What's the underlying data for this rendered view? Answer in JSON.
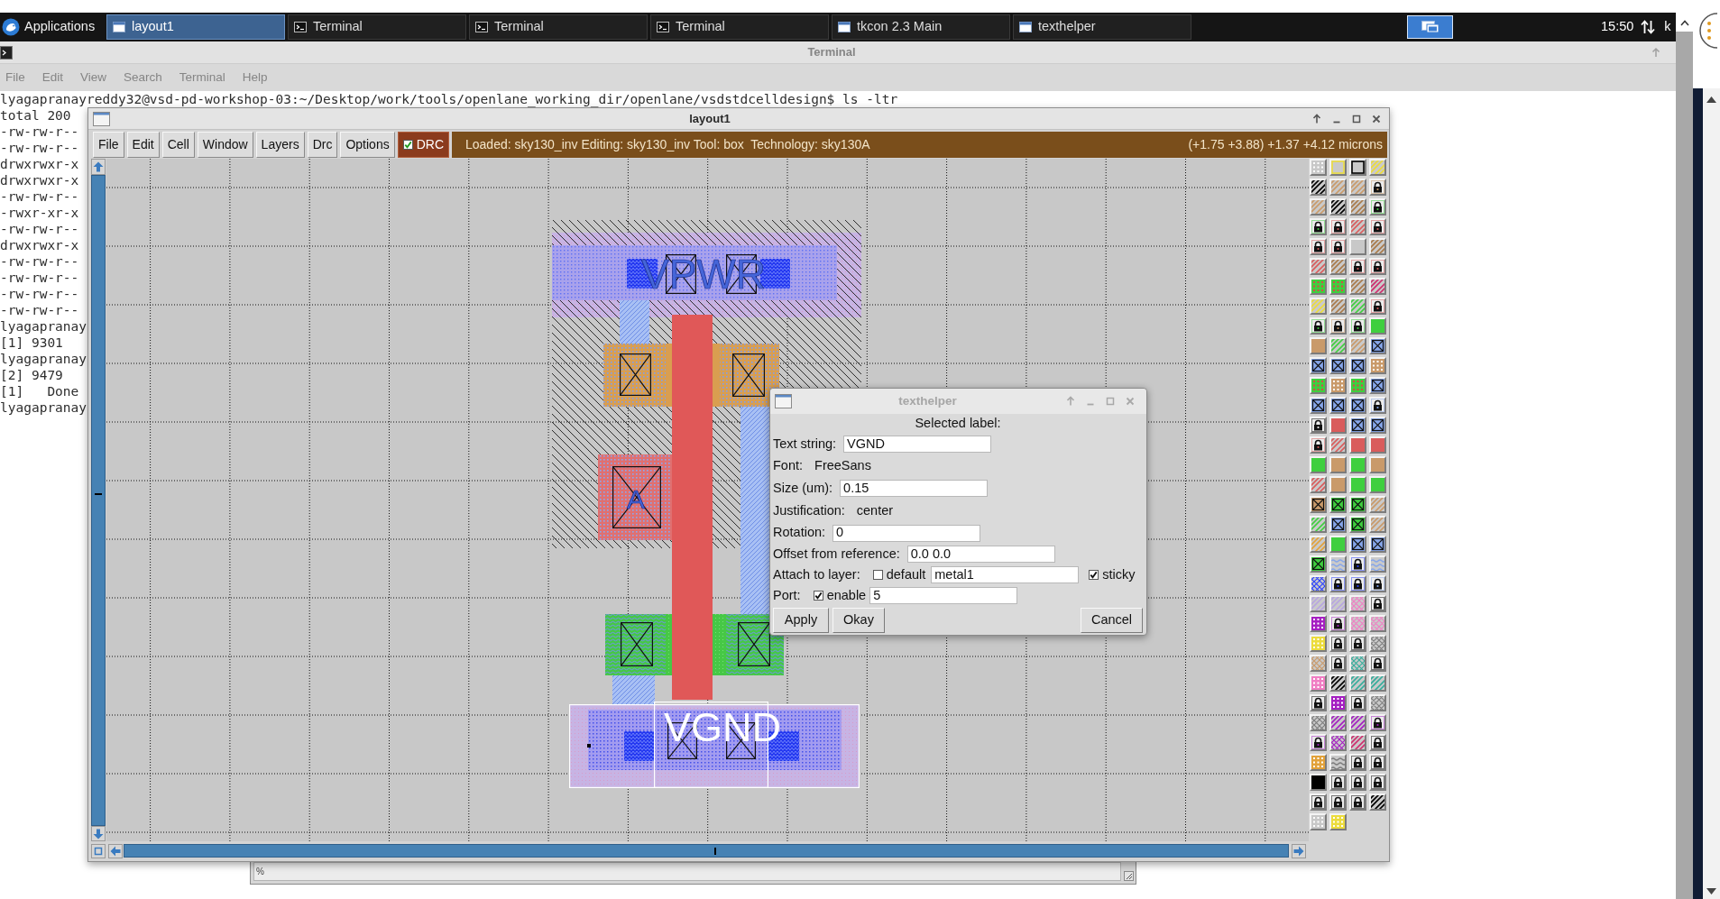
{
  "taskbar": {
    "menu": "Applications",
    "tasks": [
      {
        "label": "layout1",
        "kind": "window",
        "selected": true
      },
      {
        "label": "Terminal",
        "kind": "terminal",
        "selected": false
      },
      {
        "label": "Terminal",
        "kind": "terminal",
        "selected": false
      },
      {
        "label": "Terminal",
        "kind": "terminal",
        "selected": false
      },
      {
        "label": "tkcon 2.3 Main",
        "kind": "window",
        "selected": false
      },
      {
        "label": "texthelper",
        "kind": "window",
        "selected": false
      }
    ],
    "clock": "15:50",
    "tray_text": "k"
  },
  "terminal": {
    "title": "Terminal",
    "menu": [
      "File",
      "Edit",
      "View",
      "Search",
      "Terminal",
      "Help"
    ],
    "lines": [
      "lyagapranayreddy32@vsd-pd-workshop-03:~/Desktop/work/tools/openlane_working_dir/openlane/vsdstdcelldesign$ ls -ltr",
      "total 200",
      "-rw-rw-r--",
      "-rw-rw-r--",
      "drwxrwxr-x",
      "drwxrwxr-x",
      "-rw-rw-r--",
      "-rwxr-xr-x",
      "-rw-rw-r--",
      "drwxrwxr-x",
      "-rw-rw-r--",
      "-rw-rw-r--",
      "-rw-rw-r--",
      "-rw-rw-r--",
      "lyagapranay",
      "[1] 9301",
      "lyagapranay",
      "[2] 9479",
      "[1]   Done",
      "lyagapranay"
    ]
  },
  "layout_window": {
    "title": "layout1",
    "menu": [
      "File",
      "Edit",
      "Cell",
      "Window",
      "Layers",
      "Drc",
      "Options"
    ],
    "drc": {
      "label": "DRC",
      "checked": true
    },
    "status": "Loaded: sky130_inv Editing: sky130_inv Tool: box  Technology: sky130A",
    "coordinates": "(+1.75 +3.88) +1.37 +4.12 microns",
    "labels": [
      {
        "text": "VPWR",
        "selected": false
      },
      {
        "text": "A",
        "selected": false
      },
      {
        "text": "VGND",
        "selected": true
      }
    ]
  },
  "texthelper": {
    "title": "texthelper",
    "heading": "Selected label:",
    "rows": [
      {
        "kind": "entry",
        "label": "Text string:",
        "value": "VGND"
      },
      {
        "kind": "info",
        "label": "Font:",
        "value": "FreeSans"
      },
      {
        "kind": "entry",
        "label": "Size (um):",
        "value": "0.15"
      },
      {
        "kind": "info",
        "label": "Justification:",
        "value": "center"
      },
      {
        "kind": "entry",
        "label": "Rotation:",
        "value": "0"
      },
      {
        "kind": "entry",
        "label": "Offset from reference:",
        "value": "0.0 0.0"
      },
      {
        "kind": "layer",
        "label": "Attach to layer:",
        "option": {
          "label": "default",
          "checked": false
        },
        "value": "metal1",
        "sticky": {
          "label": "sticky",
          "checked": true
        }
      },
      {
        "kind": "port",
        "label": "Port:",
        "option": {
          "label": "enable",
          "checked": true
        },
        "value": "5"
      }
    ],
    "buttons": [
      "Apply",
      "Okay",
      "Cancel"
    ]
  },
  "console": {
    "prompt": "%"
  }
}
